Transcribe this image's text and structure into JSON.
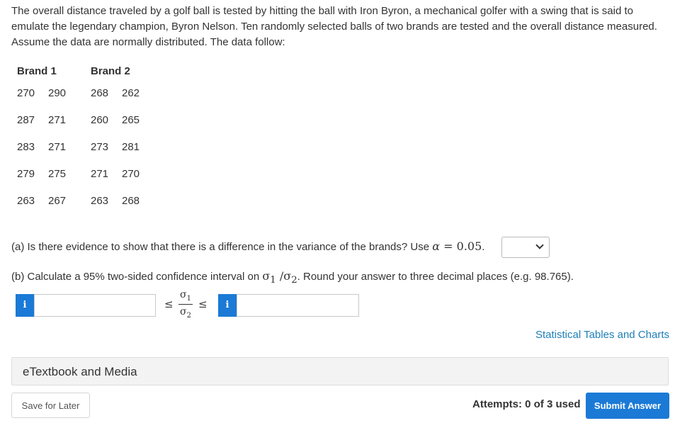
{
  "problem": {
    "intro": "The overall distance traveled by a golf ball is tested by hitting the ball with Iron Byron, a mechanical golfer with a swing that is said to emulate the legendary champion, Byron Nelson. Ten randomly selected balls of two brands are tested and the overall distance measured. Assume the data are normally distributed. The data follow:"
  },
  "table": {
    "headers": [
      "Brand 1",
      "Brand 2"
    ],
    "rows": [
      [
        "270",
        "290",
        "268",
        "262"
      ],
      [
        "287",
        "271",
        "260",
        "265"
      ],
      [
        "283",
        "271",
        "273",
        "281"
      ],
      [
        "279",
        "275",
        "271",
        "270"
      ],
      [
        "263",
        "267",
        "263",
        "268"
      ]
    ]
  },
  "part_a": {
    "text": "(a) Is there evidence to show that there is a difference in the variance of the brands? Use",
    "alpha_symbol": "α",
    "equals": "=",
    "alpha_value": "0.05",
    "period": ".",
    "select_value": ""
  },
  "part_b": {
    "text_before": "(b) Calculate a 95% two-sided confidence interval on",
    "sigma1": "σ",
    "sub1": "1",
    "slash": " /",
    "sigma2": "σ",
    "sub2": "2",
    "text_after": ". Round your answer to three decimal places (e.g. 98.765).",
    "info_glyph": "i",
    "lower_value": "",
    "upper_value": "",
    "le": "≤"
  },
  "links": {
    "tables": "Statistical Tables and Charts"
  },
  "etext": {
    "label": "eTextbook and Media"
  },
  "footer": {
    "save_label": "Save for Later",
    "attempts": "Attempts: 0 of 3 used",
    "submit_label": "Submit Answer"
  },
  "colors": {
    "accent": "#1b7ad6",
    "link": "#1e7fb7"
  }
}
